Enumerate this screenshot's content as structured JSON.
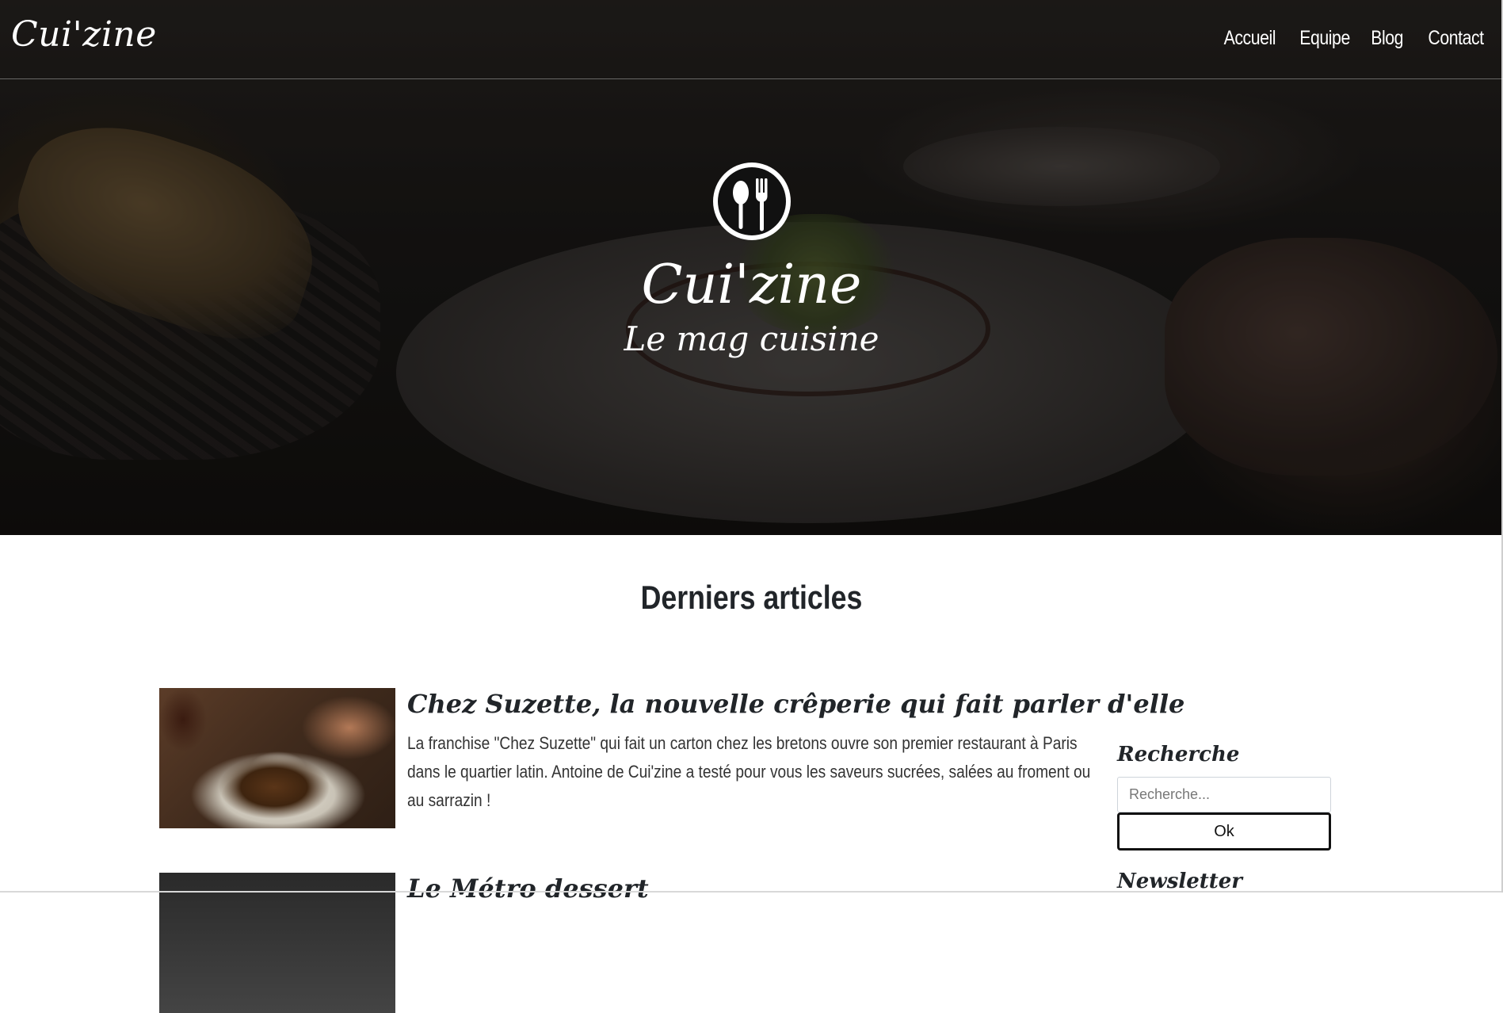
{
  "navbar": {
    "brand": "Cui'zine",
    "links": [
      {
        "label": "Accueil"
      },
      {
        "label": "Equipe"
      },
      {
        "label": "Blog"
      },
      {
        "label": "Contact"
      }
    ]
  },
  "hero": {
    "icon": "spoon-fork-icon",
    "title": "Cui'zine",
    "subtitle": "Le mag cuisine"
  },
  "main": {
    "section_title": "Derniers articles",
    "articles": [
      {
        "title": "Chez Suzette, la nouvelle crêperie qui fait parler d'elle",
        "text": "La franchise \"Chez Suzette\" qui fait un carton chez les bretons ouvre son premier restaurant à Paris dans le quartier latin. Antoine de Cui'zine a testé pour vous les saveurs sucrées, salées au froment ou au sarrazin !"
      },
      {
        "title": "Le Métro dessert",
        "text": ""
      }
    ]
  },
  "sidebar": {
    "search_title": "Recherche",
    "search_placeholder": "Recherche...",
    "search_button": "Ok",
    "newsletter_title": "Newsletter"
  },
  "colors": {
    "text_dark": "#212529",
    "white": "#ffffff",
    "button_border": "#111111"
  }
}
